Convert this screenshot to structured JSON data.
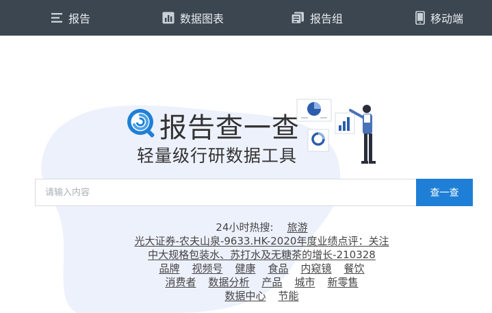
{
  "nav": {
    "items": [
      {
        "label": "报告",
        "icon": "list-icon"
      },
      {
        "label": "数据图表",
        "icon": "chart-icon"
      },
      {
        "label": "报告组",
        "icon": "report-group-icon"
      },
      {
        "label": "移动端",
        "icon": "mobile-icon"
      }
    ]
  },
  "hero": {
    "title": "报告查一查",
    "slogan": "轻量级行研数据工具"
  },
  "search": {
    "placeholder": "请输入内容",
    "button": "查一查"
  },
  "hot": {
    "label": "24小时热搜:",
    "first": "旅游",
    "long_item": "光大证券-农夫山泉-9633.HK-2020年度业绩点评：关注中大规格包装水、苏打水及无糖茶的增长-210328",
    "row1": [
      "品牌",
      "视频号",
      "健康",
      "食品",
      "内窥镜",
      "餐饮"
    ],
    "row2": [
      "消费者",
      "数据分析",
      "产品",
      "城市",
      "新零售"
    ],
    "row3": [
      "数据中心",
      "节能"
    ]
  },
  "colors": {
    "nav_bg": "#3b4650",
    "accent": "#1f7fd6",
    "blob": "#edf1fc"
  }
}
